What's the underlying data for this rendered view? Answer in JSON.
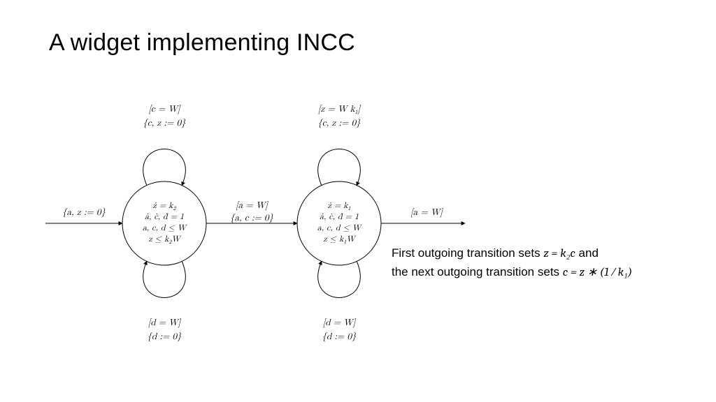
{
  "title": "A widget implementing INCC",
  "side_text": {
    "line1_pre": "First outgoing transition sets ",
    "line1_eq": "z = k₂c",
    "line1_post": " and",
    "line2_pre": "the next outgoing transition sets ",
    "line2_eq": "c = z ∗ (1 ⁄ k₁)"
  },
  "automaton": {
    "states": [
      {
        "id": "q1",
        "invariants": [
          "ż = k₂",
          "ȧ, ċ, ḋ = 1",
          "a, c, d ≤ W",
          "z ≤ k₂W"
        ],
        "top_loop": {
          "guard": "[c = W]",
          "reset": "{c, z := 0}"
        },
        "bottom_loop": {
          "guard": "[d = W]",
          "reset": "{d := 0}"
        }
      },
      {
        "id": "q2",
        "invariants": [
          "ż = k₁",
          "ȧ, ċ, ḋ = 1",
          "a, c, d ≤ W",
          "z ≤ k₁W"
        ],
        "top_loop": {
          "guard": "[z = Wk₁]",
          "reset": "{c, z := 0}"
        },
        "bottom_loop": {
          "guard": "[d = W]",
          "reset": "{d := 0}"
        }
      }
    ],
    "edges": {
      "init": {
        "reset": "{a, z := 0}"
      },
      "q1_q2": {
        "guard": "[a = W]",
        "reset": "{a, c := 0}"
      },
      "q2_out": {
        "guard": "[a = W]"
      }
    }
  },
  "chart_data": {
    "type": "diagram",
    "nodes": [
      {
        "id": "q1",
        "label_lines": [
          {
            "lhs": "ż",
            "op": "=",
            "rhs": "k₂"
          },
          {
            "lhs": "ȧ, ċ, ḋ",
            "op": "=",
            "rhs": "1"
          },
          {
            "lhs": "a, c, d",
            "op": "≤",
            "rhs": "W"
          },
          {
            "lhs": "z",
            "op": "≤",
            "rhs": "k₂W"
          }
        ],
        "self_loops": [
          {
            "side": "top",
            "guard": "[ c = W ]",
            "reset": "{ c, z := 0 }"
          },
          {
            "side": "bottom",
            "guard": "[ d = W ]",
            "reset": "{ d := 0 }"
          }
        ]
      },
      {
        "id": "q2",
        "label_lines": [
          {
            "lhs": "ż",
            "op": "=",
            "rhs": "k₁"
          },
          {
            "lhs": "ȧ, ċ, ḋ",
            "op": "=",
            "rhs": "1"
          },
          {
            "lhs": "a, c, d",
            "op": "≤",
            "rhs": "W"
          },
          {
            "lhs": "z",
            "op": "≤",
            "rhs": "k₁W"
          }
        ],
        "self_loops": [
          {
            "side": "top",
            "guard": "[ z = W k₁ ]",
            "reset": "{ c, z := 0 }"
          },
          {
            "side": "bottom",
            "guard": "[ d = W ]",
            "reset": "{ d := 0 }"
          }
        ]
      }
    ],
    "edges": [
      {
        "from": "start",
        "to": "q1",
        "guard": null,
        "reset": "{ a, z := 0 }"
      },
      {
        "from": "q1",
        "to": "q2",
        "guard": "[ a = W ]",
        "reset": "{ a, c := 0 }"
      },
      {
        "from": "q2",
        "to": "end",
        "guard": "[ a = W ]",
        "reset": null
      }
    ],
    "title": "A widget implementing INCC",
    "annotations": [
      "First outgoing transition sets z = k₂ c",
      "the next outgoing transition sets c = z * (1/k₁)"
    ]
  }
}
